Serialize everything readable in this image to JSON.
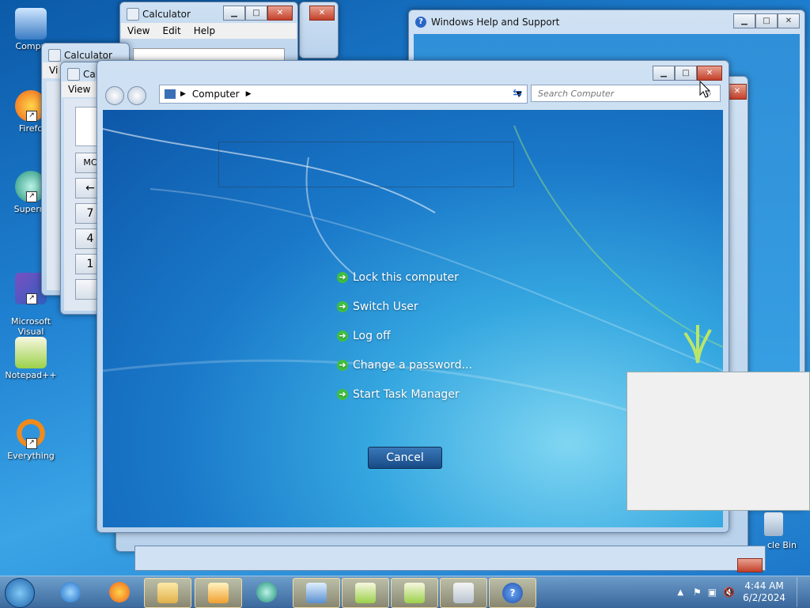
{
  "desktop": {
    "icons": [
      {
        "label": "Compu"
      },
      {
        "label": "Firefo"
      },
      {
        "label": "Superm"
      },
      {
        "label": "Microsoft\nVisual Stud..."
      },
      {
        "label": "Notepad++"
      },
      {
        "label": "Everything"
      }
    ],
    "recycle_bin": "cle Bin"
  },
  "calculator_back": {
    "title": "Calculator",
    "menu": [
      "View",
      "Edit",
      "Help"
    ]
  },
  "calculator_mid": {
    "title": "Calculator",
    "menu": [
      "Vi"
    ]
  },
  "calculator_front": {
    "title": "Cal",
    "menu": [
      "View"
    ],
    "buttons": [
      "MC",
      "←",
      "7",
      "4",
      "1"
    ]
  },
  "help_window": {
    "title": "Windows Help and Support"
  },
  "explorer": {
    "breadcrumb": "Computer",
    "search_placeholder": "Search Computer"
  },
  "secure_desktop": {
    "options": [
      "Lock this computer",
      "Switch User",
      "Log off",
      "Change a password...",
      "Start Task Manager"
    ],
    "cancel_label": "Cancel"
  },
  "taskbar": {
    "time": "4:44 AM",
    "date": "6/2/2024"
  },
  "colors": {
    "accent": "#1a78c9",
    "option_arrow": "#3fbf3f"
  }
}
